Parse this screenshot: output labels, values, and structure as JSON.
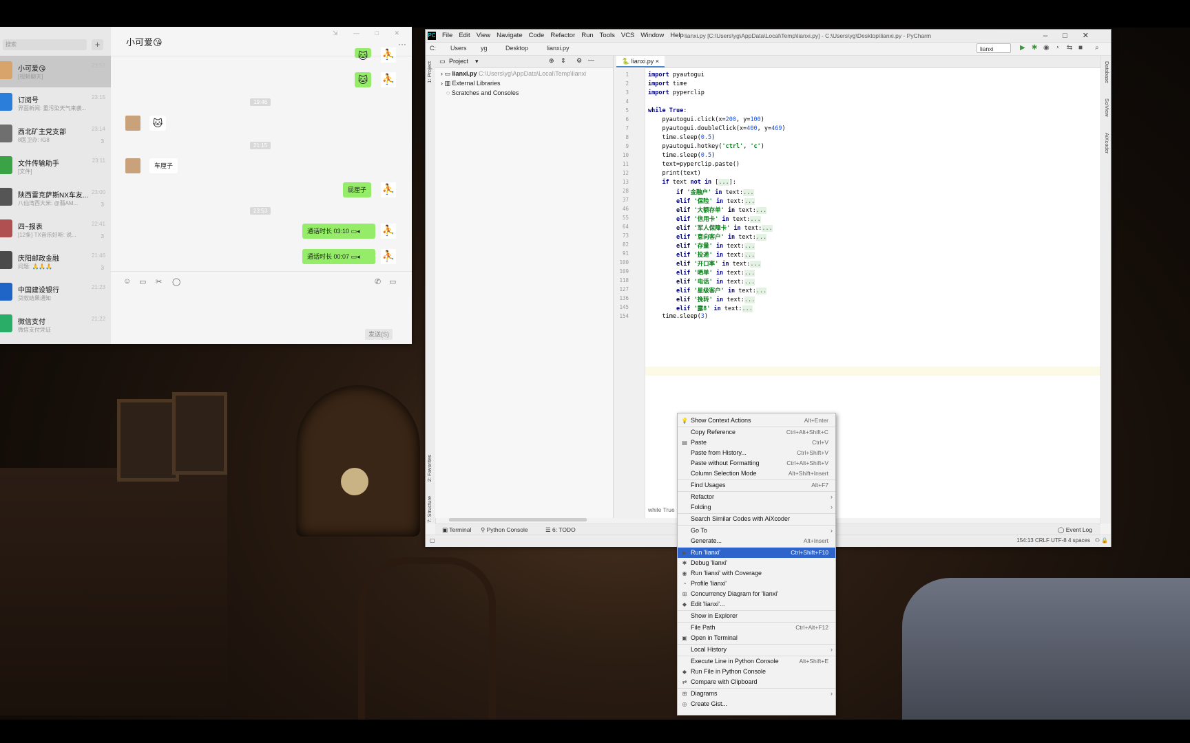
{
  "wechat": {
    "search_placeholder": "搜索",
    "plus": "+",
    "title": "小可爱😘",
    "more": "···",
    "winctl": "⇲ — □ ✕",
    "conversations": [
      {
        "name": "小可爱😘",
        "preview": "[视频聊天]",
        "time": "23:57",
        "badge": ""
      },
      {
        "name": "订阅号",
        "preview": "界面新闻: 重污染天气来袭...",
        "time": "23:15",
        "badge": ""
      },
      {
        "name": "西北矿主党支部",
        "preview": "8医卫办: IG8",
        "time": "23:14",
        "badge": "3"
      },
      {
        "name": "文件传输助手",
        "preview": "[文件]",
        "time": "23:11",
        "badge": ""
      },
      {
        "name": "陕西雷克萨斯NX车友...",
        "preview": "八仙湾西大米: @翡AM...",
        "time": "23:00",
        "badge": "3"
      },
      {
        "name": "四~报表",
        "preview": "[12条] TX音乐好听: 说...",
        "time": "22:41",
        "badge": "3"
      },
      {
        "name": "庆阳邮政金融",
        "preview": "问题: 🙏🙏🙏",
        "time": "21:46",
        "badge": "3"
      },
      {
        "name": "中国建设银行",
        "preview": "贷款结果通知",
        "time": "21:23",
        "badge": ""
      },
      {
        "name": "微信支付",
        "preview": "微信支付凭证",
        "time": "21:22",
        "badge": ""
      }
    ],
    "stamps": [
      "19:46",
      "21:15",
      "23:53"
    ],
    "msg_car": "车厘子",
    "msg_car_reply": "屁厘子",
    "call1": "通话时长 03:10",
    "call2": "通话时长 00:07",
    "send": "发送(S)"
  },
  "pycharm": {
    "menu": [
      "File",
      "Edit",
      "View",
      "Navigate",
      "Code",
      "Refactor",
      "Run",
      "Tools",
      "VCS",
      "Window",
      "Help"
    ],
    "window_title": "lianxi.py [C:\\Users\\yg\\AppData\\Local\\Temp\\lianxi.py] - C:\\Users\\yg\\Desktop\\lianxi.py - PyCharm",
    "crumbs": [
      "C:",
      "Users",
      "yg",
      "Desktop",
      "lianxi.py"
    ],
    "run_config": "lianxi",
    "project_label": "Project",
    "tree": {
      "root": "lianxi.py",
      "root_path": "C:\\Users\\yg\\AppData\\Local\\Temp\\lianxi",
      "ext": "External Libraries",
      "scratch": "Scratches and Consoles"
    },
    "tab": "lianxi.py",
    "left_tabs": [
      "1: Project",
      "2: Favorites",
      "7: Structure"
    ],
    "right_tabs": [
      "Database",
      "SciView",
      "AiXcoder"
    ],
    "lines": [
      {
        "n": "1",
        "t": "import pyautogui"
      },
      {
        "n": "2",
        "t": "import time"
      },
      {
        "n": "3",
        "t": "import pyperclip"
      },
      {
        "n": "4",
        "t": ""
      },
      {
        "n": "5",
        "t": "while True:"
      },
      {
        "n": "6",
        "t": "    pyautogui.click(x=200, y=100)"
      },
      {
        "n": "7",
        "t": "    pyautogui.doubleClick(x=400, y=469)"
      },
      {
        "n": "8",
        "t": "    time.sleep(0.5)"
      },
      {
        "n": "9",
        "t": "    pyautogui.hotkey('ctrl', 'c')"
      },
      {
        "n": "10",
        "t": "    time.sleep(0.5)"
      },
      {
        "n": "11",
        "t": "    text=pyperclip.paste()"
      },
      {
        "n": "12",
        "t": "    print(text)"
      },
      {
        "n": "13",
        "t": "    if text not in [...]:"
      },
      {
        "n": "28",
        "t": "        if '金融户' in text:..."
      },
      {
        "n": "37",
        "t": "        elif '保险' in text:..."
      },
      {
        "n": "46",
        "t": "        elif '大额存单' in text:..."
      },
      {
        "n": "55",
        "t": "        elif '信用卡' in text:..."
      },
      {
        "n": "64",
        "t": "        elif '军人保障卡' in text:..."
      },
      {
        "n": "73",
        "t": "        elif '意向客户' in text:..."
      },
      {
        "n": "82",
        "t": "        elif '存量' in text:..."
      },
      {
        "n": "91",
        "t": "        elif '投递' in text:..."
      },
      {
        "n": "100",
        "t": "        elif '开口率' in text:..."
      },
      {
        "n": "109",
        "t": "        elif '晒单' in text:..."
      },
      {
        "n": "118",
        "t": "        elif '电话' in text:..."
      },
      {
        "n": "127",
        "t": "        elif '星级客户' in text:..."
      },
      {
        "n": "136",
        "t": "        elif '挽转' in text:..."
      },
      {
        "n": "145",
        "t": "        elif '露8' in text:..."
      },
      {
        "n": "154",
        "t": "    time.sleep(3)"
      }
    ],
    "breadcrumb_bottom": "while True",
    "bottom_tabs": [
      "Terminal",
      "Python Console",
      "6: TODO"
    ],
    "event_log": "Event Log",
    "status": "154:13  CRLF  UTF-8  4 spaces"
  },
  "context_menu": [
    {
      "label": "Show Context Actions",
      "shortcut": "Alt+Enter",
      "icon": "bulb-icon"
    },
    {
      "label": "Copy Reference",
      "shortcut": "Ctrl+Alt+Shift+C"
    },
    {
      "label": "Paste",
      "shortcut": "Ctrl+V",
      "icon": "clipboard-icon"
    },
    {
      "label": "Paste from History...",
      "shortcut": "Ctrl+Shift+V"
    },
    {
      "label": "Paste without Formatting",
      "shortcut": "Ctrl+Alt+Shift+V"
    },
    {
      "label": "Column Selection Mode",
      "shortcut": "Alt+Shift+Insert"
    },
    {
      "label": "Find Usages",
      "shortcut": "Alt+F7"
    },
    {
      "label": "Refactor",
      "shortcut": "",
      "submenu": true
    },
    {
      "label": "Folding",
      "shortcut": "",
      "submenu": true
    },
    {
      "label": "Search Similar Codes with AiXcoder",
      "shortcut": ""
    },
    {
      "label": "Go To",
      "shortcut": "",
      "submenu": true
    },
    {
      "label": "Generate...",
      "shortcut": "Alt+Insert"
    },
    {
      "label": "Run 'lianxi'",
      "shortcut": "Ctrl+Shift+F10",
      "icon": "run-icon",
      "selected": true
    },
    {
      "label": "Debug 'lianxi'",
      "shortcut": "",
      "icon": "debug-icon"
    },
    {
      "label": "Run 'lianxi' with Coverage",
      "shortcut": "",
      "icon": "coverage-icon"
    },
    {
      "label": "Profile 'lianxi'",
      "shortcut": "",
      "icon": "profile-icon"
    },
    {
      "label": "Concurrency Diagram for 'lianxi'",
      "shortcut": "",
      "icon": "diagram-icon"
    },
    {
      "label": "Edit 'lianxi'...",
      "shortcut": "",
      "icon": "python-icon"
    },
    {
      "label": "Show in Explorer",
      "shortcut": ""
    },
    {
      "label": "File Path",
      "shortcut": "Ctrl+Alt+F12"
    },
    {
      "label": "Open in Terminal",
      "shortcut": "",
      "icon": "terminal-icon"
    },
    {
      "label": "Local History",
      "shortcut": "",
      "submenu": true
    },
    {
      "label": "Execute Line in Python Console",
      "shortcut": "Alt+Shift+E"
    },
    {
      "label": "Run File in Python Console",
      "shortcut": "",
      "icon": "python-icon"
    },
    {
      "label": "Compare with Clipboard",
      "shortcut": "",
      "icon": "compare-icon"
    },
    {
      "label": "Diagrams",
      "shortcut": "",
      "icon": "diagram-icon",
      "submenu": true
    },
    {
      "label": "Create Gist...",
      "shortcut": "",
      "icon": "github-icon"
    }
  ]
}
